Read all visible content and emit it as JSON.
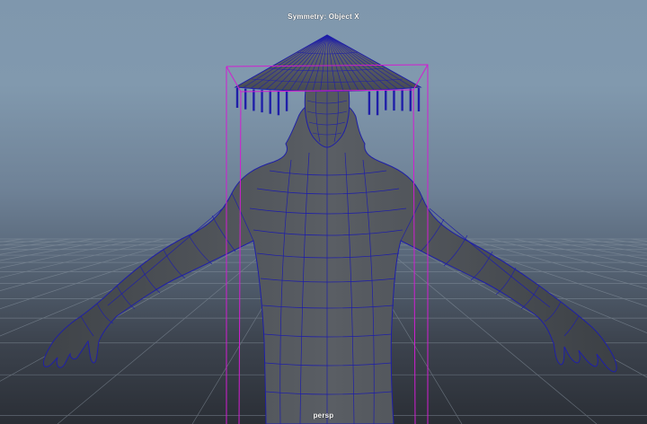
{
  "viewport": {
    "symmetry_label": "Symmetry: Object X",
    "camera_label": "persp"
  },
  "scene": {
    "model": "character-with-conical-hat",
    "display_mode": "shaded-wireframe",
    "colors": {
      "sky_top": "#7f97ad",
      "ground": "#2a2e35",
      "grid": "#8b97a3",
      "body_fill": "#52565c",
      "wire": "#1f1fa8",
      "bounding_box": "#d21ed2",
      "label": "#ffffff"
    }
  }
}
